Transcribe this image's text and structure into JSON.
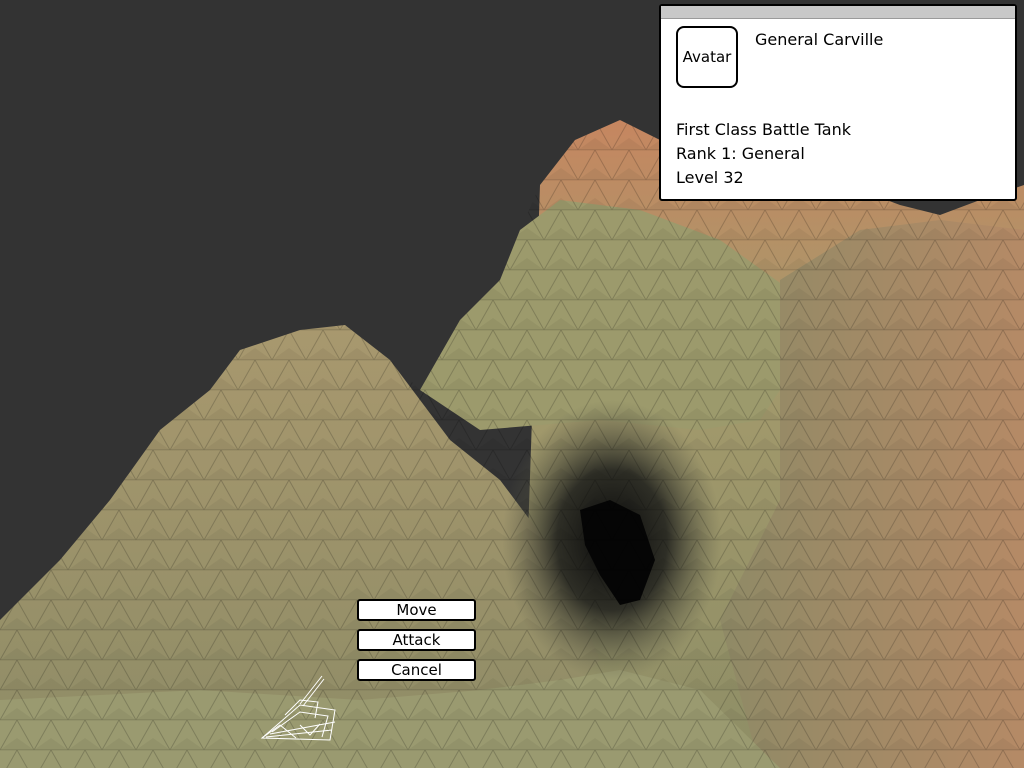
{
  "info_panel": {
    "avatar_label": "Avatar",
    "unit_name": "General Carville",
    "unit_class": "First Class Battle Tank",
    "rank": "Rank 1: General",
    "level": "Level 32"
  },
  "action_menu": {
    "move_label": "Move",
    "attack_label": "Attack",
    "cancel_label": "Cancel"
  },
  "colors": {
    "background": "#333333",
    "terrain_low": "#9a9a66",
    "terrain_high": "#c98a5e",
    "panel_bg": "#ffffff",
    "tank_wireframe": "#ffffff"
  },
  "icons": {
    "unit": "tank-wireframe-icon"
  }
}
